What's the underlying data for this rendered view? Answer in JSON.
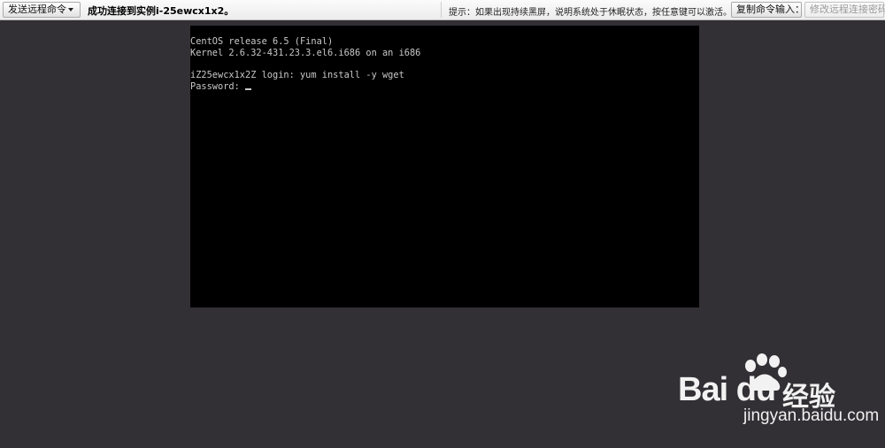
{
  "toolbar": {
    "send_command_label": "发送远程命令",
    "status_text": "成功连接到实例i-25ewcx1x2。",
    "hint_text": "提示：如果出现持续黑屏，说明系统处于休眠状态，按任意键可以激活。",
    "copy_command_label": "复制命令输入：",
    "change_password_label": "修改远程连接密码"
  },
  "terminal": {
    "lines": [
      "CentOS release 6.5 (Final)",
      "Kernel 2.6.32-431.23.3.el6.i686 on an i686",
      "",
      "iZ25ewcx1x2Z login: yum install -y wget",
      "Password: "
    ]
  },
  "watermark": {
    "logo_text": "Bai du",
    "suffix_text": "经验",
    "url_text": "jingyan.baidu.com"
  },
  "colors": {
    "background": "#323034",
    "terminal_bg": "#000000",
    "terminal_fg": "#c8c8c8"
  }
}
